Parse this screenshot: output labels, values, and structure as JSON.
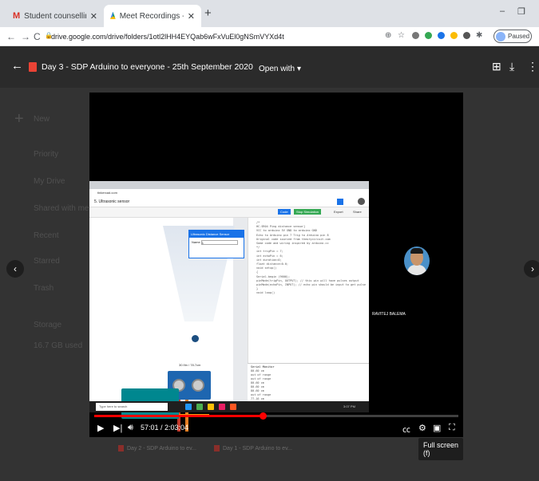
{
  "browser": {
    "tabs": [
      {
        "label": "Student counselling list update",
        "icon": "M"
      },
      {
        "label": "Meet Recordings - Google Drive",
        "icon": "drive"
      }
    ],
    "new_tab": "+",
    "url": "drive.google.com/drive/folders/1otl2lHH4EYQab6wFxVuEl0gNSmVYXd4t",
    "profile_status": "Paused"
  },
  "viewer": {
    "file_title": "Day 3 - SDP Arduino to everyone - 25th September 2020",
    "open_with": "Open with",
    "background_sidebar": [
      "New",
      "Priority",
      "My Drive",
      "Shared with me",
      "Recent",
      "Starred",
      "Trash",
      "Storage",
      "16.7 GB used"
    ],
    "background_files": [
      "Day 2 - SDP Arduino to ev...",
      "Day 1 - SDP Arduino to ev..."
    ]
  },
  "screen_share": {
    "project_title": "5. Ultrasonic sensor",
    "code_btn": "Code",
    "sim_btn": "Stop Simulation",
    "export": "Export",
    "share": "Share",
    "panel_title": "Ultrasonic Distance Sensor",
    "panel_name_label": "Name",
    "panel_name_value": "1",
    "sensor_label": "30.9in / 78.7cm",
    "code_lines": [
      "/*",
      "  HC-SR04 Ping distance sensor]",
      "  VCC to arduino 5V GND to arduino GND",
      "  Echo to Arduino pin 7 Trig to Arduino pin 8",
      "  Original code sourced from theorycircuit.com",
      "  Some code and wiring inspired by arduino.cc",
      "*/",
      "int trigPin = 7;",
      "int echoPin = 6;",
      "int duration=0;",
      "float distance=0.0;",
      "void setup()",
      "{",
      "  Serial.begin (9600);",
      "  pinMode(trigPin, OUTPUT); // this pin will have pulses output",
      "  pinMode(echoPin, INPUT); // echo pin should be input to get pulse",
      "}",
      "void loop()"
    ],
    "serial_title": "Serial Monitor",
    "serial_lines": [
      "80.60 cm",
      "out of range",
      "out of range",
      "80.60 cm",
      "80.60 cm",
      "80.60 cm",
      "out of range",
      "77.16 cm"
    ],
    "taskbar_search": "Type here to search",
    "taskbar_time": "3:07 PM"
  },
  "participant": {
    "name": "RAVITEJ BALEMA"
  },
  "player": {
    "tooltip": "Full screen (f)",
    "time": "57:01 / 2:03:04",
    "progress": 0.463
  }
}
